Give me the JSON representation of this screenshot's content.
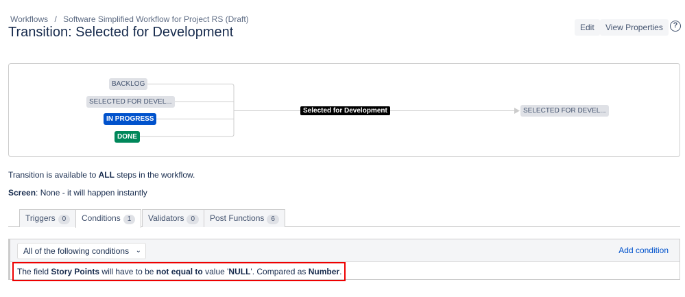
{
  "breadcrumb": [
    "Workflows",
    "/",
    "Software Simplified Workflow for Project RS (Draft)"
  ],
  "title": "Transition: Selected for Development",
  "buttons": {
    "edit": "Edit",
    "view_properties": "View Properties",
    "help": "?"
  },
  "diagram": {
    "sources": [
      {
        "label": "BACKLOG",
        "color": "#dfe1e6"
      },
      {
        "label": "SELECTED FOR DEVEL...",
        "color": "#dfe1e6"
      },
      {
        "label": "IN PROGRESS",
        "color": "#0052cc"
      },
      {
        "label": "DONE",
        "color": "#00875a"
      }
    ],
    "transition": "Selected for Development",
    "target": "SELECTED FOR DEVEL..."
  },
  "info": {
    "available_pre": "Transition is available to ",
    "available_bold": "ALL",
    "available_post": " steps in the workflow.",
    "screen_label": "Screen",
    "screen_value": ": None - it will happen instantly"
  },
  "tabs": [
    {
      "label": "Triggers",
      "count": "0"
    },
    {
      "label": "Conditions",
      "count": "1"
    },
    {
      "label": "Validators",
      "count": "0"
    },
    {
      "label": "Post Functions",
      "count": "6"
    }
  ],
  "conditions": {
    "select": "All of the following conditions",
    "add": "Add condition",
    "text": {
      "p1": "The field ",
      "field": "Story Points",
      "p2": " will have to be ",
      "op": "not equal to",
      "p3": " value '",
      "value": "NULL",
      "p4": "'. Compared as ",
      "type": "Number",
      "p5": "."
    }
  }
}
